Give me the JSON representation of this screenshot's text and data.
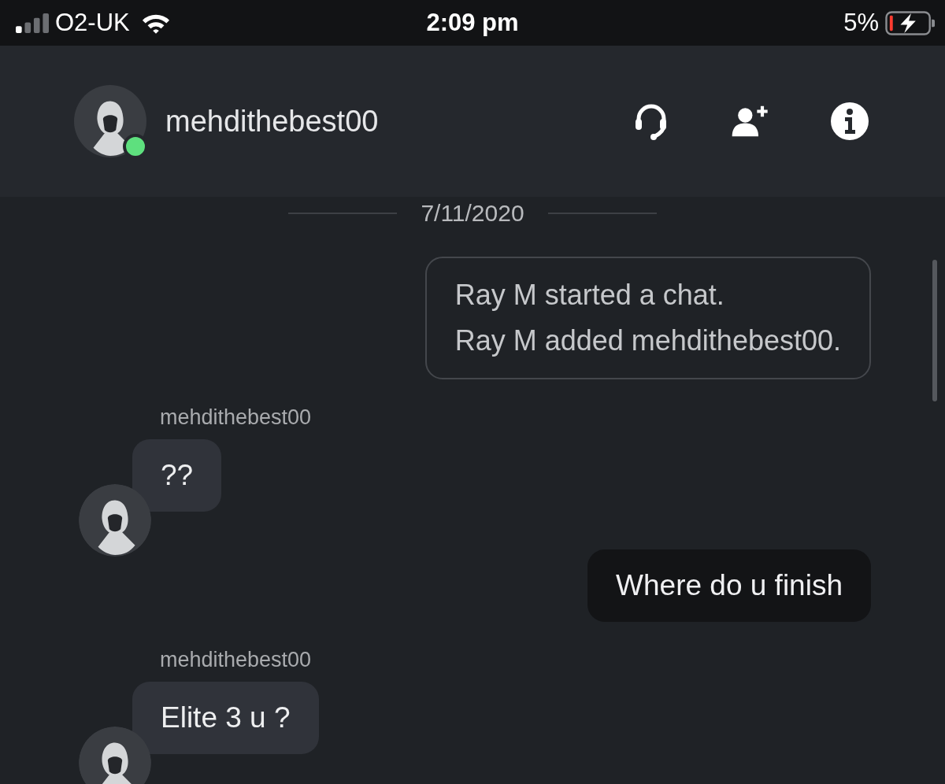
{
  "status_bar": {
    "carrier": "O2-UK",
    "time": "2:09 pm",
    "battery": "5%"
  },
  "header": {
    "name": "mehdithebest00",
    "online": true
  },
  "messages": [
    {
      "kind": "date",
      "text": "7/11/2020"
    },
    {
      "kind": "system",
      "lines": [
        "Ray M started a chat.",
        "Ray M added mehdithebest00."
      ]
    },
    {
      "kind": "incoming",
      "sender": "mehdithebest00",
      "text": "??"
    },
    {
      "kind": "outgoing",
      "text": "Where do u finish"
    },
    {
      "kind": "incoming",
      "sender": "mehdithebest00",
      "text": "Elite 3 u ?"
    }
  ]
}
